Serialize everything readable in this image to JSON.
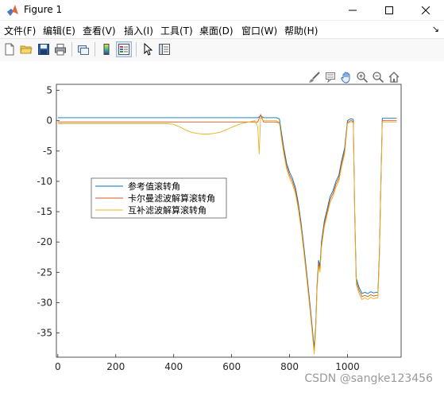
{
  "window": {
    "title": "Figure 1"
  },
  "menu": {
    "items": [
      "文件(F)",
      "编辑(E)",
      "查看(V)",
      "插入(I)",
      "工具(T)",
      "桌面(D)",
      "窗口(W)",
      "帮助(H)"
    ]
  },
  "toolbar": {
    "buttons": [
      "new-figure",
      "open-file",
      "save",
      "print",
      "link-plot",
      "insert-colorbar",
      "insert-legend",
      "edit-plot",
      "open-property-inspector"
    ]
  },
  "axes_toolbar": {
    "buttons": [
      "brush",
      "data-tips",
      "pan",
      "zoom-in",
      "zoom-out",
      "restore-view"
    ]
  },
  "colors": {
    "series1": "#0072BD",
    "series2": "#D95319",
    "series3": "#EDB120"
  },
  "chart_data": {
    "type": "line",
    "title": "",
    "xlabel": "",
    "ylabel": "",
    "xlim": [
      -5,
      1185
    ],
    "ylim": [
      -39,
      6
    ],
    "xticks": [
      0,
      200,
      400,
      600,
      800,
      1000
    ],
    "xtick_labels": [
      "0",
      "200",
      "400",
      "600",
      "800",
      "1000"
    ],
    "yticks": [
      5,
      0,
      -5,
      -10,
      -15,
      -20,
      -25,
      -30,
      -35
    ],
    "ytick_labels": [
      "5",
      "0",
      "-5",
      "-10",
      "-15",
      "-20",
      "-25",
      "-30",
      "-35"
    ],
    "grid": false,
    "legend_position": "inside-left",
    "series": [
      {
        "name": "参考值滚转角",
        "x": [
          0,
          690,
          700,
          710,
          755,
          765,
          772,
          780,
          790,
          800,
          810,
          820,
          830,
          840,
          850,
          860,
          870,
          880,
          885,
          890,
          895,
          900,
          905,
          910,
          920,
          930,
          940,
          950,
          960,
          970,
          980,
          990,
          1000,
          1010,
          1015,
          1020,
          1025,
          1030,
          1040,
          1050,
          1060,
          1070,
          1080,
          1090,
          1100,
          1105,
          1110,
          1120,
          1150,
          1170
        ],
        "y": [
          0.5,
          0.5,
          0.8,
          0.5,
          0.5,
          0.3,
          -2.0,
          -4.5,
          -7.0,
          -8.5,
          -9.5,
          -11.0,
          -13.5,
          -17.0,
          -21.0,
          -25.5,
          -30.0,
          -35.0,
          -37.5,
          -34.0,
          -27.0,
          -23.0,
          -24.0,
          -20.0,
          -16.5,
          -14.5,
          -12.5,
          -11.5,
          -10.0,
          -9.0,
          -6.5,
          -4.5,
          0.0,
          0.3,
          0.3,
          0.2,
          -15.0,
          -26.0,
          -27.5,
          -28.5,
          -28.3,
          -28.5,
          -28.2,
          -28.4,
          -28.3,
          -28.3,
          -22.0,
          0.4,
          0.4,
          0.4
        ]
      },
      {
        "name": "卡尔曼滤波解算滚转角",
        "x": [
          0,
          690,
          700,
          710,
          755,
          765,
          772,
          780,
          790,
          800,
          810,
          820,
          830,
          840,
          850,
          860,
          870,
          880,
          885,
          890,
          895,
          900,
          905,
          910,
          920,
          930,
          940,
          950,
          960,
          970,
          980,
          990,
          1000,
          1010,
          1015,
          1020,
          1025,
          1030,
          1040,
          1050,
          1060,
          1070,
          1080,
          1090,
          1100,
          1105,
          1110,
          1120,
          1150,
          1170
        ],
        "y": [
          -0.2,
          -0.2,
          1.0,
          -0.2,
          -0.2,
          -0.4,
          -2.5,
          -5.0,
          -7.5,
          -9.0,
          -10.0,
          -11.5,
          -14.0,
          -17.5,
          -21.5,
          -26.0,
          -30.5,
          -35.5,
          -38.0,
          -34.5,
          -27.5,
          -23.5,
          -24.5,
          -20.5,
          -17.0,
          -15.0,
          -13.0,
          -12.0,
          -10.5,
          -9.5,
          -7.0,
          -5.0,
          -0.3,
          0.0,
          0.0,
          -0.2,
          -15.5,
          -26.5,
          -28.0,
          -29.0,
          -28.8,
          -29.0,
          -28.7,
          -28.9,
          -28.8,
          -28.8,
          -22.5,
          0.0,
          0.0,
          0.0
        ]
      },
      {
        "name": "互补滤波解算滚转角",
        "x": [
          0,
          380,
          400,
          420,
          440,
          460,
          480,
          500,
          520,
          540,
          560,
          580,
          600,
          620,
          640,
          660,
          680,
          690,
          695,
          700,
          710,
          755,
          765,
          772,
          780,
          790,
          800,
          810,
          820,
          830,
          840,
          850,
          860,
          870,
          880,
          885,
          890,
          895,
          900,
          905,
          910,
          920,
          930,
          940,
          950,
          960,
          970,
          980,
          990,
          1000,
          1010,
          1015,
          1020,
          1025,
          1030,
          1040,
          1050,
          1060,
          1070,
          1080,
          1090,
          1100,
          1105,
          1110,
          1120,
          1150,
          1170
        ],
        "y": [
          -0.5,
          -0.5,
          -0.6,
          -1.0,
          -1.5,
          -1.9,
          -2.1,
          -2.2,
          -2.2,
          -2.1,
          -1.9,
          -1.5,
          -1.1,
          -0.7,
          -0.4,
          -0.2,
          0.0,
          -1.0,
          -5.5,
          0.5,
          0.0,
          0.0,
          -0.3,
          -3.0,
          -5.5,
          -8.0,
          -9.5,
          -10.5,
          -12.0,
          -14.5,
          -18.0,
          -22.0,
          -26.5,
          -31.0,
          -36.0,
          -38.5,
          -35.0,
          -28.0,
          -24.0,
          -25.0,
          -21.0,
          -17.5,
          -15.5,
          -13.5,
          -12.5,
          -11.0,
          -10.0,
          -7.5,
          -5.5,
          -0.5,
          -0.2,
          -0.2,
          -0.4,
          -16.0,
          -27.0,
          -28.5,
          -29.5,
          -29.2,
          -29.5,
          -29.1,
          -29.4,
          -29.2,
          -29.2,
          -23.0,
          -0.2,
          -0.2,
          -0.2
        ]
      }
    ]
  },
  "watermark": "CSDN @sangke123456"
}
